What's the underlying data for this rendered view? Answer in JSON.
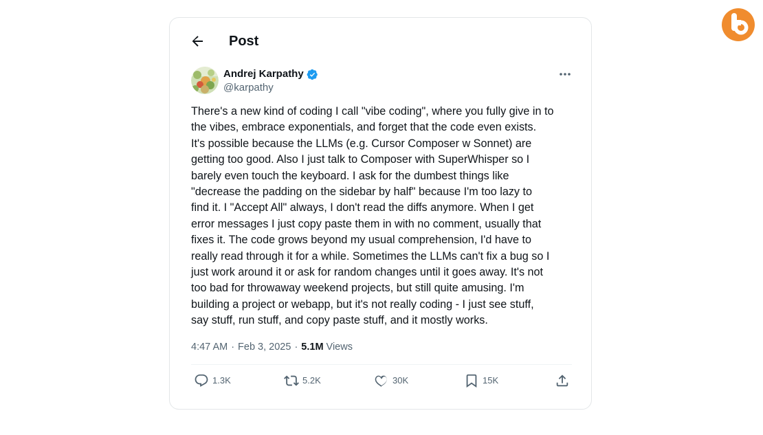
{
  "header": {
    "title": "Post"
  },
  "author": {
    "name": "Andrej Karpathy",
    "handle": "@karpathy"
  },
  "tweet": {
    "text": "There's a new kind of coding I call \"vibe coding\", where you fully give in to\nthe vibes, embrace exponentials, and forget that the code even exists.\nIt's possible because the LLMs (e.g. Cursor Composer w Sonnet) are\ngetting too good. Also I just talk to Composer with SuperWhisper so I\nbarely even touch the keyboard. I ask for the dumbest things like\n\"decrease the padding on the sidebar by half\" because I'm too lazy to\nfind it. I \"Accept All\" always, I don't read the diffs anymore. When I get\nerror messages I just copy paste them in with no comment, usually that\nfixes it. The code grows beyond my usual comprehension, I'd have to\nreally read through it for a while. Sometimes the LLMs can't fix a bug so I\njust work around it or ask for random changes until it goes away. It's not\ntoo bad for throwaway weekend projects, but still quite amusing. I'm\nbuilding a project or webapp, but it's not really coding - I just see stuff,\nsay stuff, run stuff, and copy paste stuff, and it mostly works."
  },
  "meta": {
    "time": "4:47 AM",
    "date": "Feb 3, 2025",
    "views_count": "5.1M",
    "views_label": "Views",
    "separator": "·"
  },
  "actions": {
    "replies": "1.3K",
    "reposts": "5.2K",
    "likes": "30K",
    "bookmarks": "15K"
  },
  "icons": {
    "back": "arrow-left-icon",
    "verified": "verified-badge-icon",
    "more": "more-horizontal-icon",
    "reply": "reply-icon",
    "repost": "repost-icon",
    "like": "heart-icon",
    "bookmark": "bookmark-icon",
    "share": "share-icon",
    "brand": "brand-logo-icon"
  },
  "colors": {
    "text_primary": "#0f1419",
    "text_secondary": "#536471",
    "verified_blue": "#1d9bf0",
    "brand_orange": "#f08c2e",
    "card_border": "#e3e6e8"
  }
}
